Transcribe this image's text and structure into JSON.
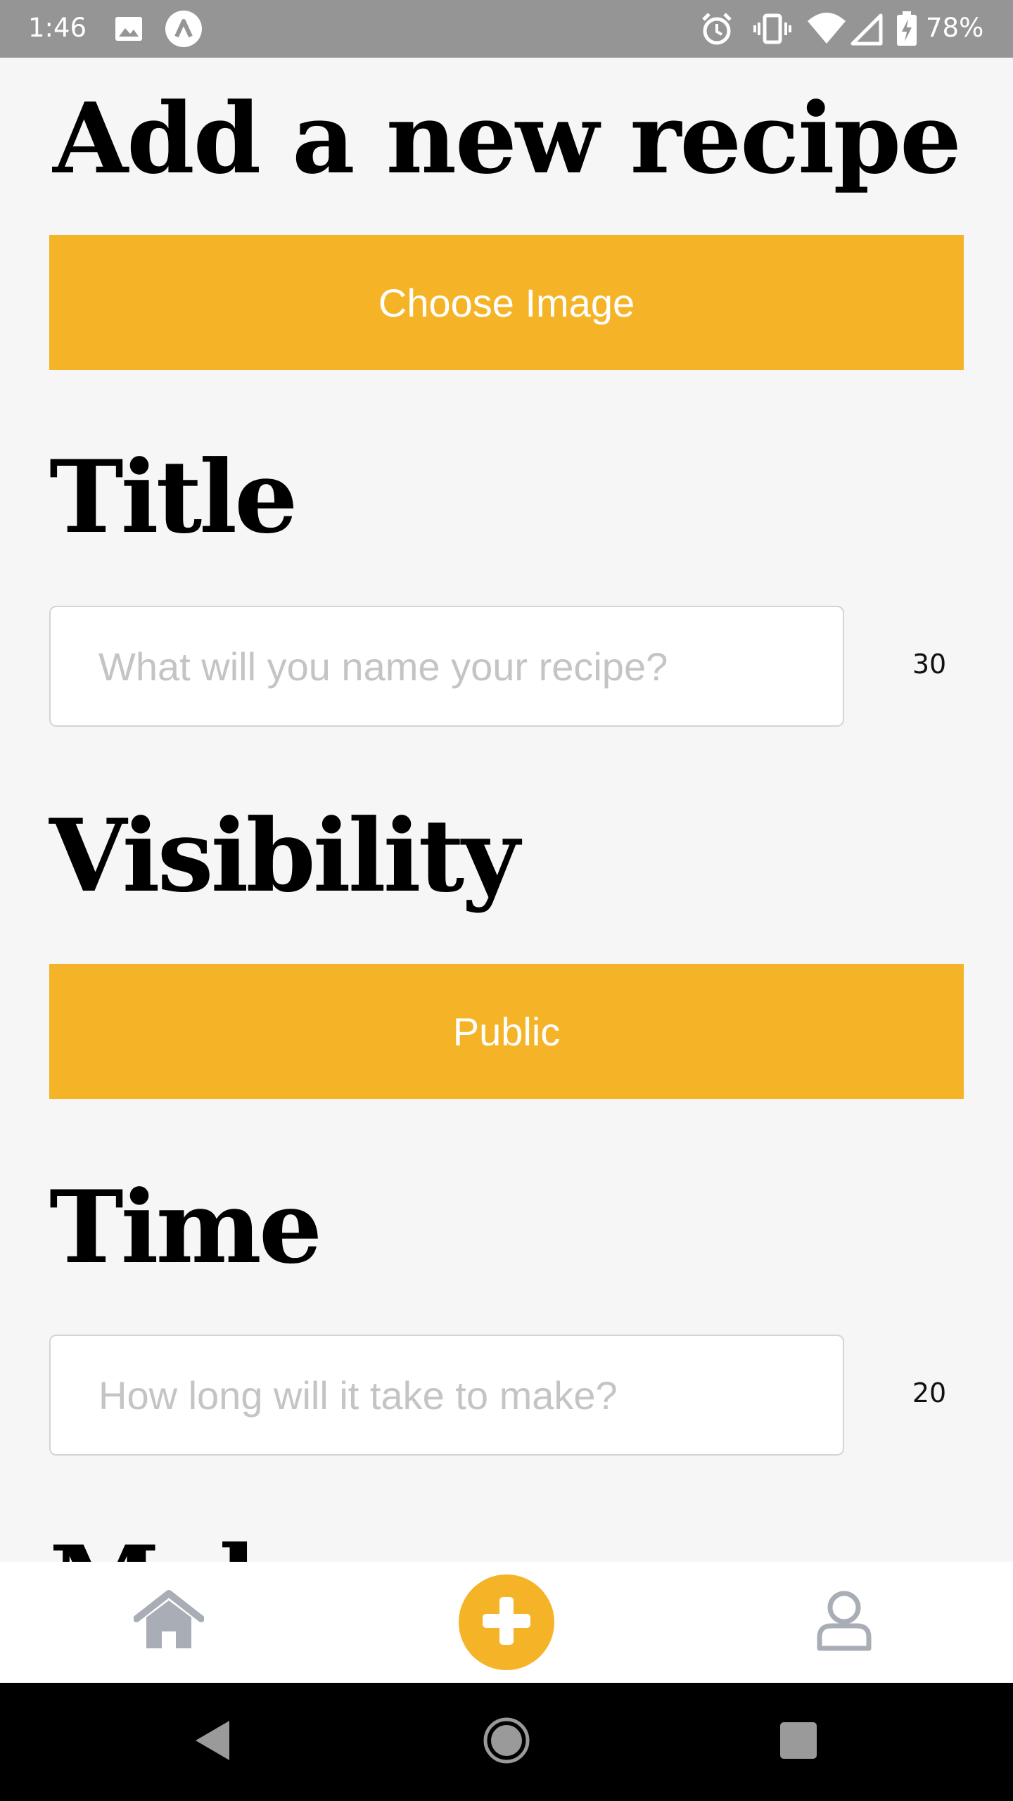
{
  "status_bar": {
    "time": "1:46",
    "battery_percent": "78%",
    "icons": [
      "image-icon",
      "app-a-icon",
      "alarm-icon",
      "vibrate-icon",
      "wifi-icon",
      "signal-icon",
      "battery-charging-icon"
    ]
  },
  "page": {
    "title": "Add a new recipe"
  },
  "image_picker": {
    "button_label": "Choose Image"
  },
  "title_section": {
    "heading": "Title",
    "placeholder": "What will you name your recipe?",
    "value": "",
    "char_limit": "30"
  },
  "visibility_section": {
    "heading": "Visibility",
    "value": "Public"
  },
  "time_section": {
    "heading": "Time",
    "placeholder": "How long will it take to make?",
    "value": "",
    "char_limit": "20"
  },
  "next_section": {
    "heading_partial": "Mak"
  },
  "tab_bar": {
    "tabs": [
      {
        "name": "home",
        "icon": "home-icon"
      },
      {
        "name": "add",
        "icon": "plus-icon"
      },
      {
        "name": "profile",
        "icon": "person-icon"
      }
    ],
    "active_color": "#f5b428",
    "inactive_color": "#a9aeb6"
  },
  "nav_bar": {
    "buttons": [
      "back-icon",
      "home-circle-icon",
      "recents-icon"
    ]
  },
  "colors": {
    "accent": "#f5b428",
    "background": "#f6f6f6",
    "status_bar": "#959595"
  }
}
